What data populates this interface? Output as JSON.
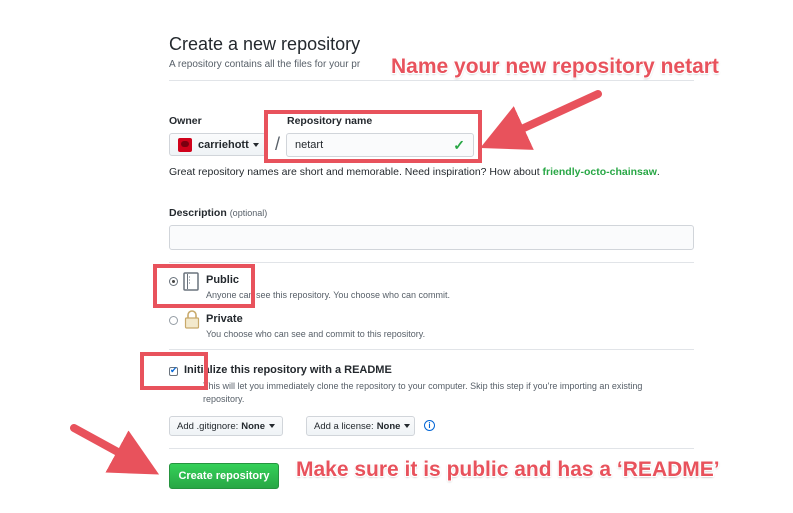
{
  "header": {
    "title": "Create a new repository",
    "subtitle": "A repository contains all the files for your pr"
  },
  "owner": {
    "label": "Owner",
    "value": "carriehott"
  },
  "slash": "/",
  "repository_name": {
    "label": "Repository name",
    "value": "netart",
    "valid": true
  },
  "hint": {
    "text": "Great repository names are short and memorable. Need inspiration? How about ",
    "suggestion": "friendly-octo-chainsaw",
    "end": "."
  },
  "description": {
    "label": "Description",
    "optional": "(optional)",
    "value": ""
  },
  "visibility": {
    "public": {
      "title": "Public",
      "desc": "Anyone can see this repository. You choose who can commit.",
      "selected": true
    },
    "private": {
      "title": "Private",
      "desc": "You choose who can see and commit to this repository.",
      "selected": false
    }
  },
  "readme": {
    "title": "Initialize this repository with a README",
    "desc": "This will let you immediately clone the repository to your computer. Skip this step if you're importing an existing repository.",
    "checked": true
  },
  "gitignore": {
    "label": "Add .gitignore:",
    "value": "None"
  },
  "license": {
    "label": "Add a license:",
    "value": "None"
  },
  "info_icon_text": "i",
  "create_button": "Create repository",
  "annotations": {
    "name_note": "Name your new repository netart",
    "public_note": "Make sure it is public and has a ‘README’",
    "color": "#e8525c"
  },
  "colors": {
    "primary_button": "#28a745",
    "valid_check": "#28a745",
    "link": "#0366d6"
  }
}
